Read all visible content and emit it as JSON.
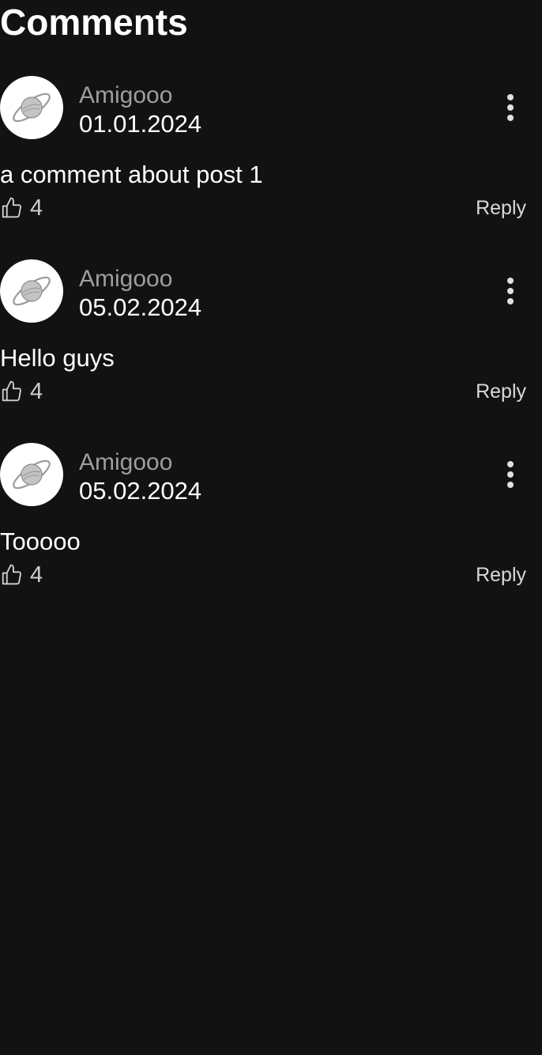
{
  "header": {
    "title": "Comments"
  },
  "comments": [
    {
      "author": "Amigooo",
      "date": "01.01.2024",
      "text": "a comment about post 1",
      "likes": "4",
      "reply_label": "Reply"
    },
    {
      "author": "Amigooo",
      "date": "05.02.2024",
      "text": "Hello guys",
      "likes": "4",
      "reply_label": "Reply"
    },
    {
      "author": "Amigooo",
      "date": "05.02.2024",
      "text": "Tooooo",
      "likes": "4",
      "reply_label": "Reply"
    }
  ],
  "icons": {
    "avatar": "planet-icon",
    "more": "more-vertical-icon",
    "like": "thumbs-up-icon"
  },
  "colors": {
    "background": "#121212",
    "author": "#9e9e9e",
    "text": "#ffffff"
  }
}
